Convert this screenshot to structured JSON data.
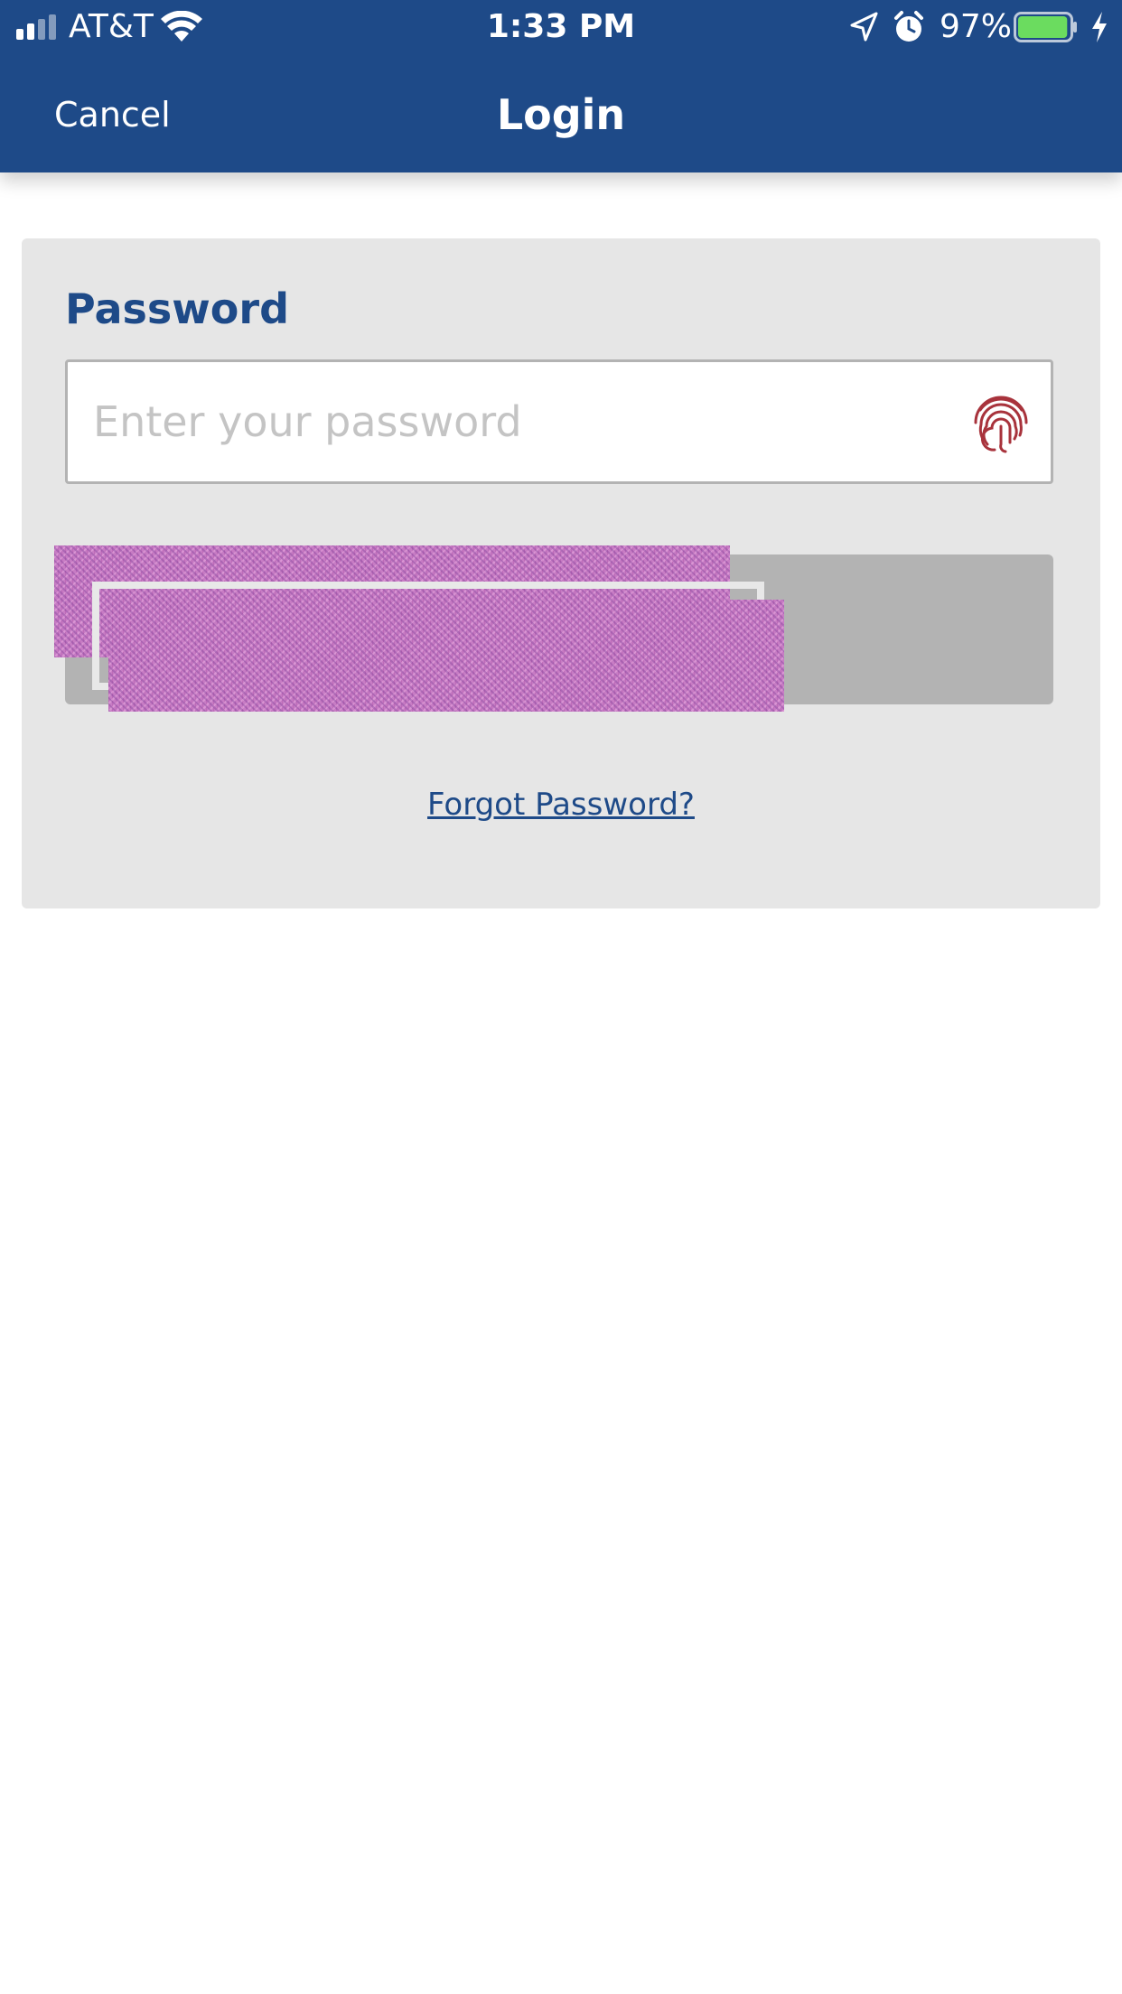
{
  "status_bar": {
    "carrier": "AT&T",
    "time": "1:33 PM",
    "battery_percent": "97%",
    "signal_bars": 4,
    "signal_bars_active": 2,
    "battery_level": 0.97,
    "battery_color": "#6bdc5f"
  },
  "nav": {
    "cancel_label": "Cancel",
    "title": "Login"
  },
  "form": {
    "password_label": "Password",
    "password_placeholder": "Enter your password",
    "password_value": "",
    "login_button_label": "",
    "forgot_password_label": "Forgot Password?"
  },
  "icons": {
    "fingerprint": "fingerprint-icon",
    "wifi": "wifi-icon",
    "location": "location-arrow-icon",
    "alarm": "alarm-clock-icon",
    "battery": "battery-icon",
    "charging": "lightning-bolt-icon"
  },
  "colors": {
    "header": "#1e4a88",
    "accent_text": "#1e4a88",
    "card_bg": "#e6e6e6",
    "button_disabled": "#b3b3b3",
    "fingerprint": "#a8333c"
  }
}
